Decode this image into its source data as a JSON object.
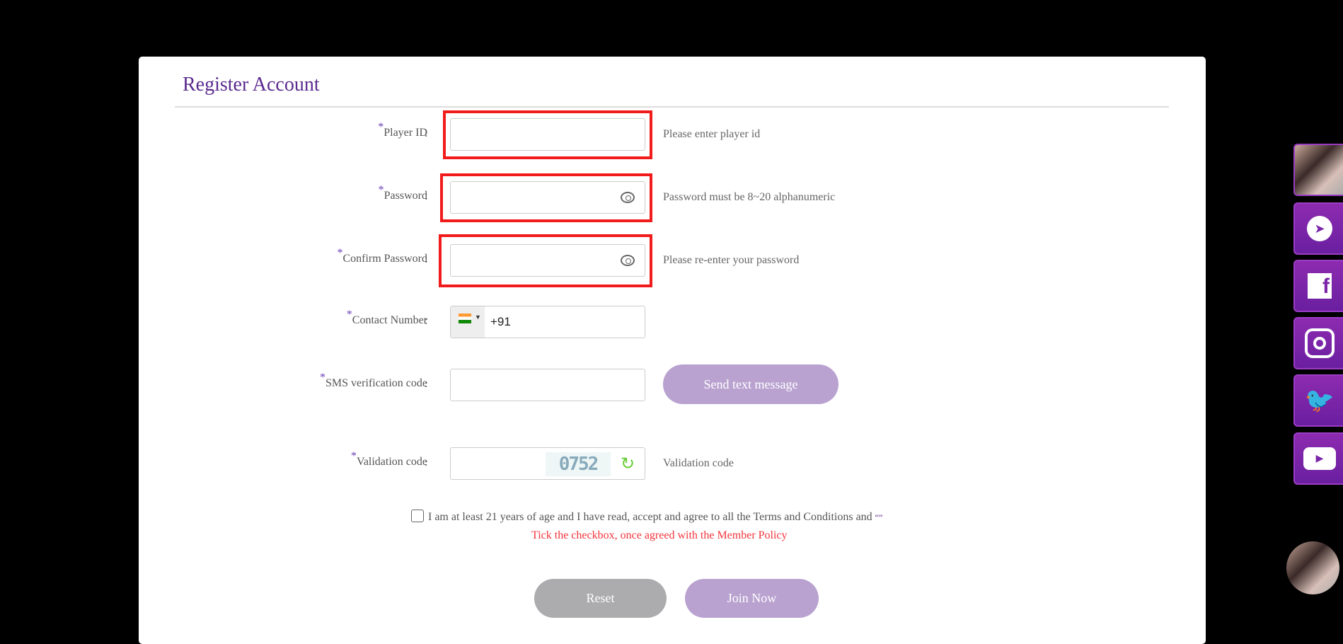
{
  "title": "Register Account",
  "colon": ":",
  "star": "*",
  "fields": {
    "player_id": {
      "label": "Player ID",
      "hint": "Please enter player id",
      "value": ""
    },
    "password": {
      "label": "Password",
      "hint": "Password must be 8~20 alphanumeric",
      "value": ""
    },
    "confirm_password": {
      "label": "Confirm Password",
      "hint": "Please re-enter your password",
      "value": ""
    },
    "contact": {
      "label": "Contact Number",
      "country_code": "+91",
      "flag": "india-flag"
    },
    "sms": {
      "label": "SMS verification code",
      "button": "Send text message"
    },
    "validation": {
      "label": "Validation code",
      "hint": "Validation code",
      "captcha": "0752"
    }
  },
  "agreement": {
    "text": "I am at least 21 years of age and I have read, accept and agree to all the Terms and Conditions and",
    "link": "“”",
    "warning": "Tick the checkbox, once agreed with the Member Policy"
  },
  "buttons": {
    "reset": "Reset",
    "join": "Join Now"
  },
  "colors": {
    "accent": "#5a2a8e",
    "button_purple": "#b9a2d0",
    "button_gray": "#acabad",
    "highlight": "#f21b1b",
    "warning": "#f2343c"
  },
  "sidebar": [
    "avatar",
    "telegram-icon",
    "facebook-icon",
    "instagram-icon",
    "twitter-icon",
    "youtube-icon"
  ]
}
